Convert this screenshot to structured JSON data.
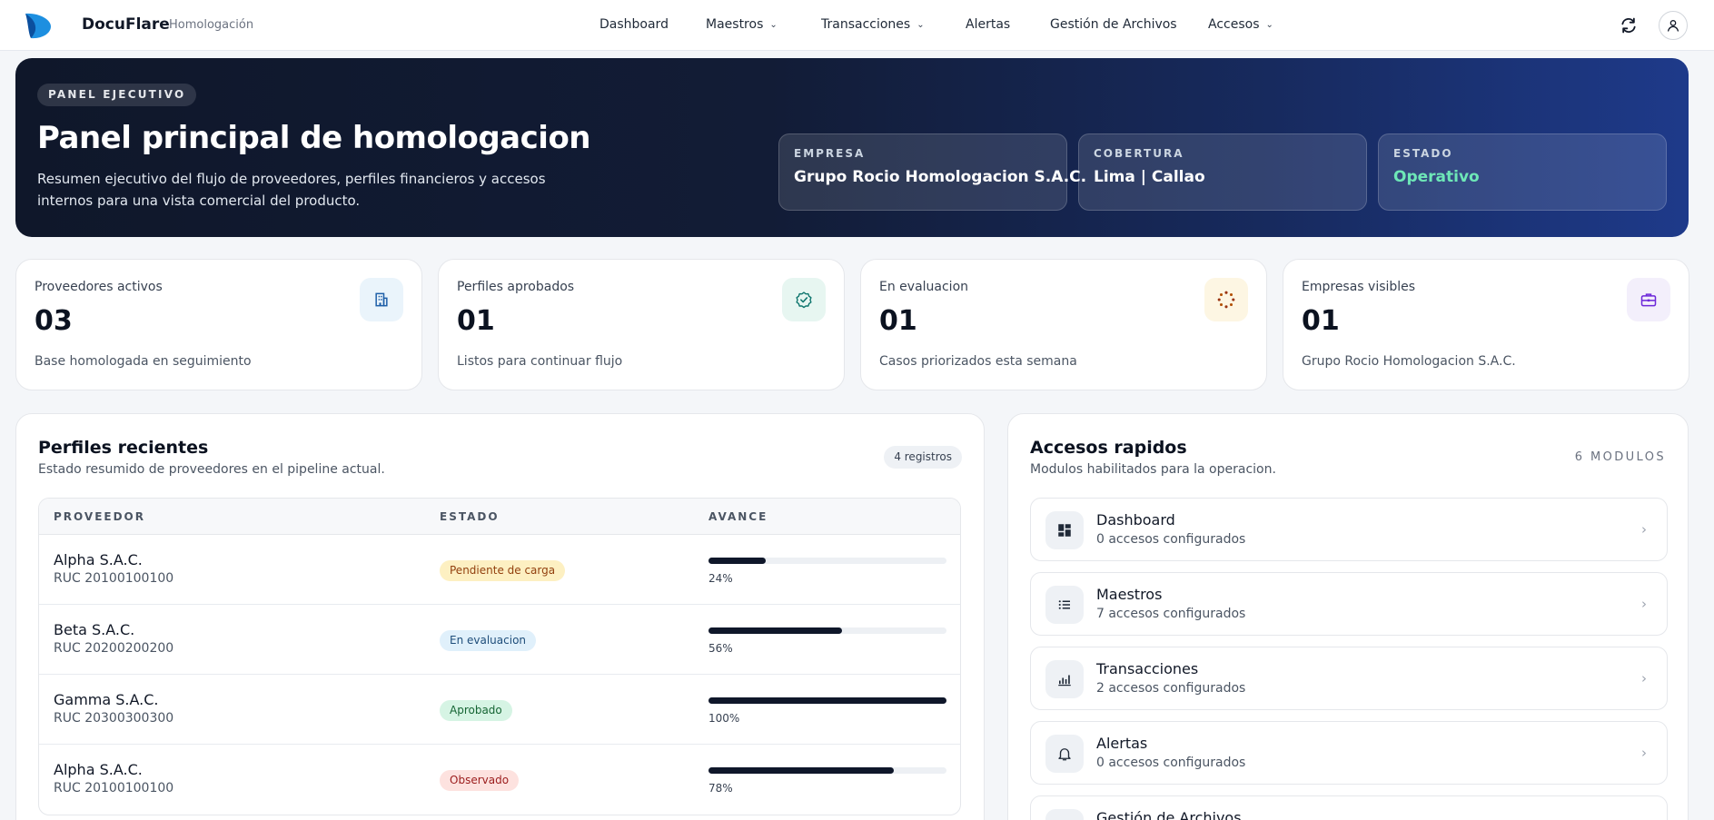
{
  "app": {
    "brand": "DocuFlare",
    "environment": "Homologación",
    "colors": {
      "brand": "#1d8fe0",
      "accent": "#0f172a",
      "ok": "#6ee7b7"
    }
  },
  "nav": {
    "items": [
      {
        "label": "Dashboard",
        "has_dropdown": false
      },
      {
        "label": "Maestros",
        "has_dropdown": true
      },
      {
        "label": "Transacciones",
        "has_dropdown": true
      },
      {
        "label": "Alertas",
        "has_dropdown": false
      },
      {
        "label": "Gestión de Archivos",
        "has_dropdown": false
      },
      {
        "label": "Accesos",
        "has_dropdown": true
      }
    ],
    "icons": [
      "sync-icon",
      "user-icon"
    ]
  },
  "hero": {
    "badge": "PANEL EJECUTIVO",
    "title": "Panel principal de homologacion",
    "description": "Resumen ejecutivo del flujo de proveedores, perfiles financieros y accesos internos para una vista comercial del producto.",
    "cards": [
      {
        "label": "EMPRESA",
        "value": "Grupo Rocio Homologacion S.A.C."
      },
      {
        "label": "COBERTURA",
        "value": "Lima | Callao"
      },
      {
        "label": "ESTADO",
        "value": "Operativo"
      }
    ]
  },
  "stats": [
    {
      "label": "Proveedores activos",
      "value": "03",
      "note": "Base homologada en seguimiento",
      "icon": "building-icon"
    },
    {
      "label": "Perfiles aprobados",
      "value": "01",
      "note": "Listos para continuar flujo",
      "icon": "verified-badge-icon"
    },
    {
      "label": "En evaluacion",
      "value": "01",
      "note": "Casos priorizados esta semana",
      "icon": "loading-icon"
    },
    {
      "label": "Empresas visibles",
      "value": "01",
      "note": "Grupo Rocio Homologacion S.A.C.",
      "icon": "briefcase-icon"
    }
  ],
  "profiles": {
    "title": "Perfiles recientes",
    "subtitle": "Estado resumido de proveedores en el pipeline actual.",
    "count": "4 registros",
    "columns": [
      "PROVEEDOR",
      "ESTADO",
      "AVANCE"
    ],
    "rows": [
      {
        "name": "Alpha S.A.C.",
        "ruc": "RUC 20100100100",
        "status": "Pendiente de carga",
        "progress": 24,
        "progress_label": "24%"
      },
      {
        "name": "Beta S.A.C.",
        "ruc": "RUC 20200200200",
        "status": "En evaluacion",
        "progress": 56,
        "progress_label": "56%"
      },
      {
        "name": "Gamma S.A.C.",
        "ruc": "RUC 20300300300",
        "status": "Aprobado",
        "progress": 100,
        "progress_label": "100%"
      },
      {
        "name": "Alpha S.A.C.",
        "ruc": "RUC 20100100100",
        "status": "Observado",
        "progress": 78,
        "progress_label": "78%"
      }
    ]
  },
  "quick_access": {
    "title": "Accesos rapidos",
    "subtitle": "Modulos habilitados para la operacion.",
    "count": "6 MODULOS",
    "items": [
      {
        "title": "Dashboard",
        "sub": "0 accesos configurados",
        "icon": "dashboard-icon"
      },
      {
        "title": "Maestros",
        "sub": "7 accesos configurados",
        "icon": "list-icon"
      },
      {
        "title": "Transacciones",
        "sub": "2 accesos configurados",
        "icon": "bar-chart-icon"
      },
      {
        "title": "Alertas",
        "sub": "0 accesos configurados",
        "icon": "bell-icon"
      },
      {
        "title": "Gestión de Archivos",
        "sub": "",
        "icon": "folder-icon"
      }
    ]
  }
}
